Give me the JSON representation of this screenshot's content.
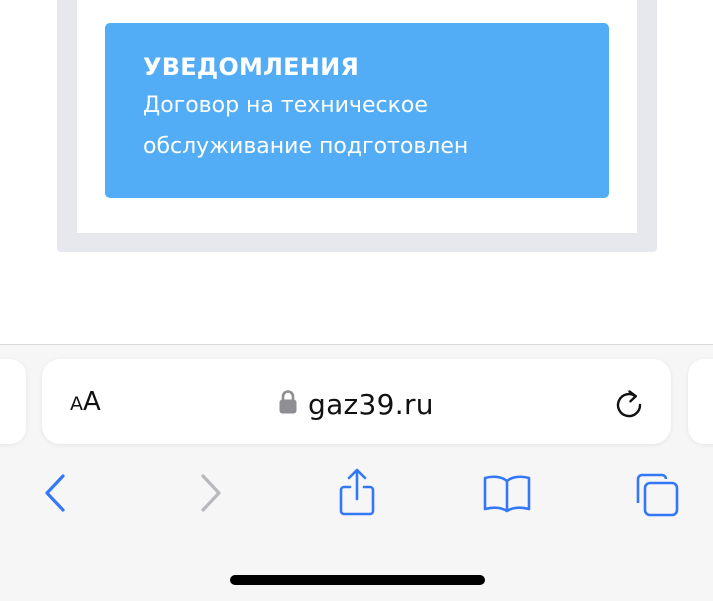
{
  "notification": {
    "title": "УВЕДОМЛЕНИЯ",
    "message": "Договор на техническое обслуживание подготовлен"
  },
  "browser": {
    "text_size_small": "A",
    "text_size_big": "A",
    "url": "gaz39.ru",
    "icons": {
      "lock": "lock-icon",
      "reload": "reload-icon",
      "back": "chevron-left-icon",
      "forward": "chevron-right-icon",
      "share": "share-icon",
      "bookmarks": "book-icon",
      "tabs": "tabs-icon"
    },
    "colors": {
      "accent": "#3478f6",
      "disabled": "#b8b8bd",
      "notice": "#52adf6"
    }
  }
}
